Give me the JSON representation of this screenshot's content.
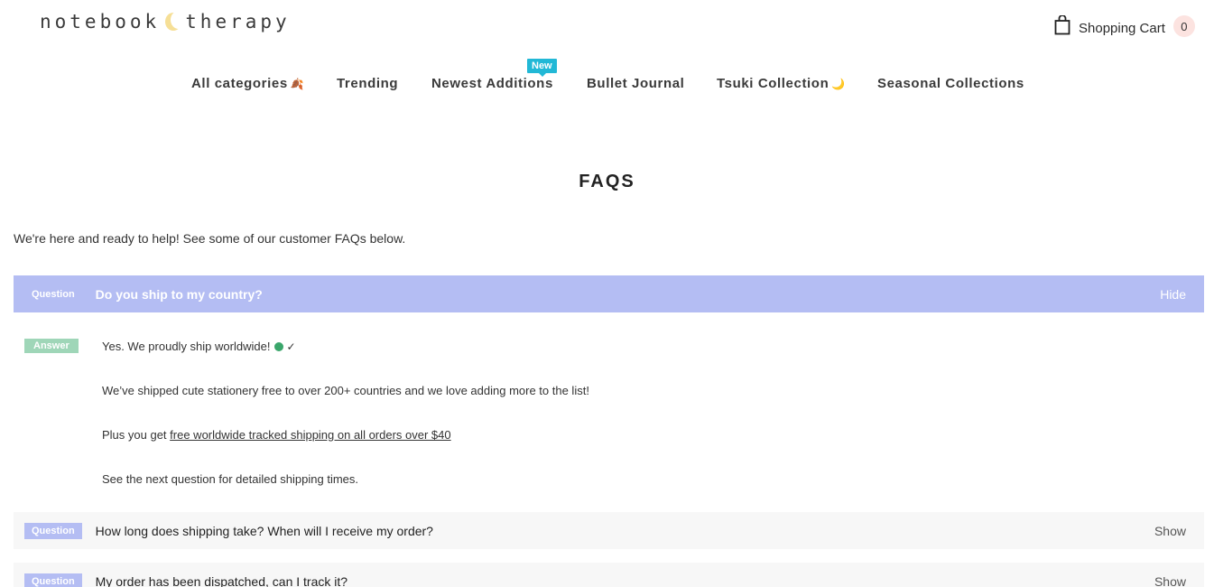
{
  "header": {
    "logo_left": "notebook",
    "logo_right": "therapy",
    "cart_label": "Shopping Cart",
    "cart_count": "0"
  },
  "nav": {
    "items": [
      {
        "label": "All categories",
        "emoji": "🍂"
      },
      {
        "label": "Trending"
      },
      {
        "label": "Newest Additions",
        "badge": "New"
      },
      {
        "label": "Bullet Journal"
      },
      {
        "label": "Tsuki Collection",
        "emoji": "🌙"
      },
      {
        "label": "Seasonal Collections"
      }
    ]
  },
  "page": {
    "title": "FAQS",
    "intro": "We're here and ready to help! See some of our customer FAQs below."
  },
  "faq": {
    "question_tag": "Question",
    "answer_tag": "Answer",
    "items": [
      {
        "question": "Do you ship to my country?",
        "toggle": "Hide"
      },
      {
        "question": "How long does shipping take? When will I receive my order?",
        "toggle": "Show"
      },
      {
        "question": "My order has been dispatched, can I track it?",
        "toggle": "Show"
      }
    ],
    "answer": {
      "line1": "Yes. We proudly ship worldwide!",
      "line1_check": "✓",
      "line2": "We’ve shipped cute stationery free to over 200+ countries and we love adding more to the list!",
      "line3_prefix": "Plus you get",
      "line3_link": "free worldwide tracked shipping on all orders over $40",
      "line4": "See the next question for detailed shipping times."
    }
  }
}
